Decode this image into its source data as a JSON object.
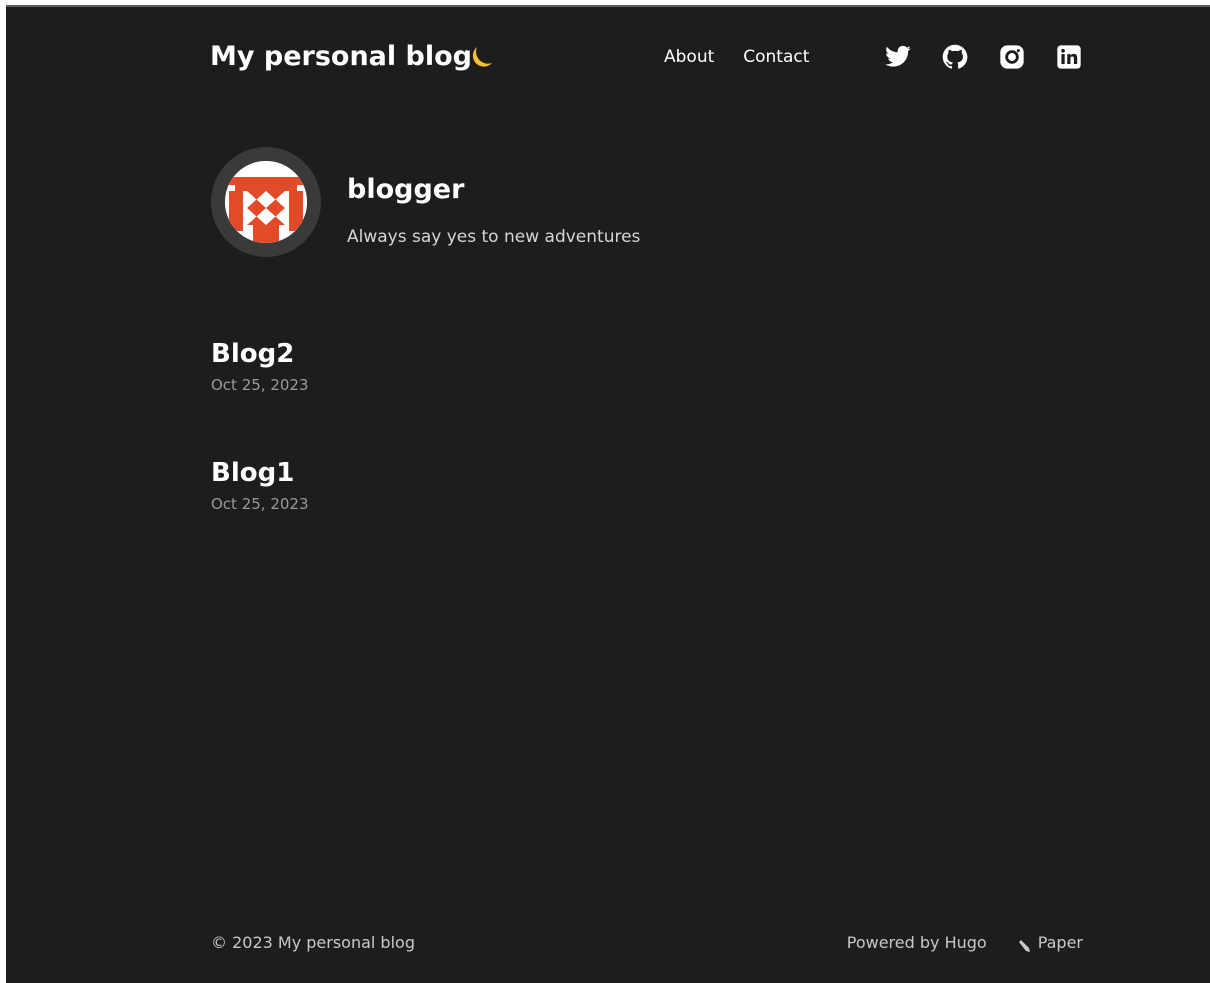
{
  "header": {
    "site_title": "My personal blog",
    "nav": [
      {
        "label": "About"
      },
      {
        "label": "Contact"
      }
    ],
    "icons": {
      "theme_toggle": "moon-icon",
      "social": [
        "twitter-icon",
        "github-icon",
        "instagram-icon",
        "linkedin-icon"
      ]
    }
  },
  "profile": {
    "name": "blogger",
    "bio": "Always say yes to new adventures"
  },
  "posts": [
    {
      "title": "Blog2",
      "date": "Oct 25, 2023"
    },
    {
      "title": "Blog1",
      "date": "Oct 25, 2023"
    }
  ],
  "footer": {
    "copyright": "© 2023 My personal blog",
    "powered": "Powered by Hugo",
    "theme": "Paper",
    "icon": "pen-icon"
  },
  "colors": {
    "background": "#1d1d1d",
    "text": "#ffffff",
    "muted": "#9a9a9a",
    "accent_moon": "#f5c132",
    "avatar_red": "#e24a2a"
  }
}
